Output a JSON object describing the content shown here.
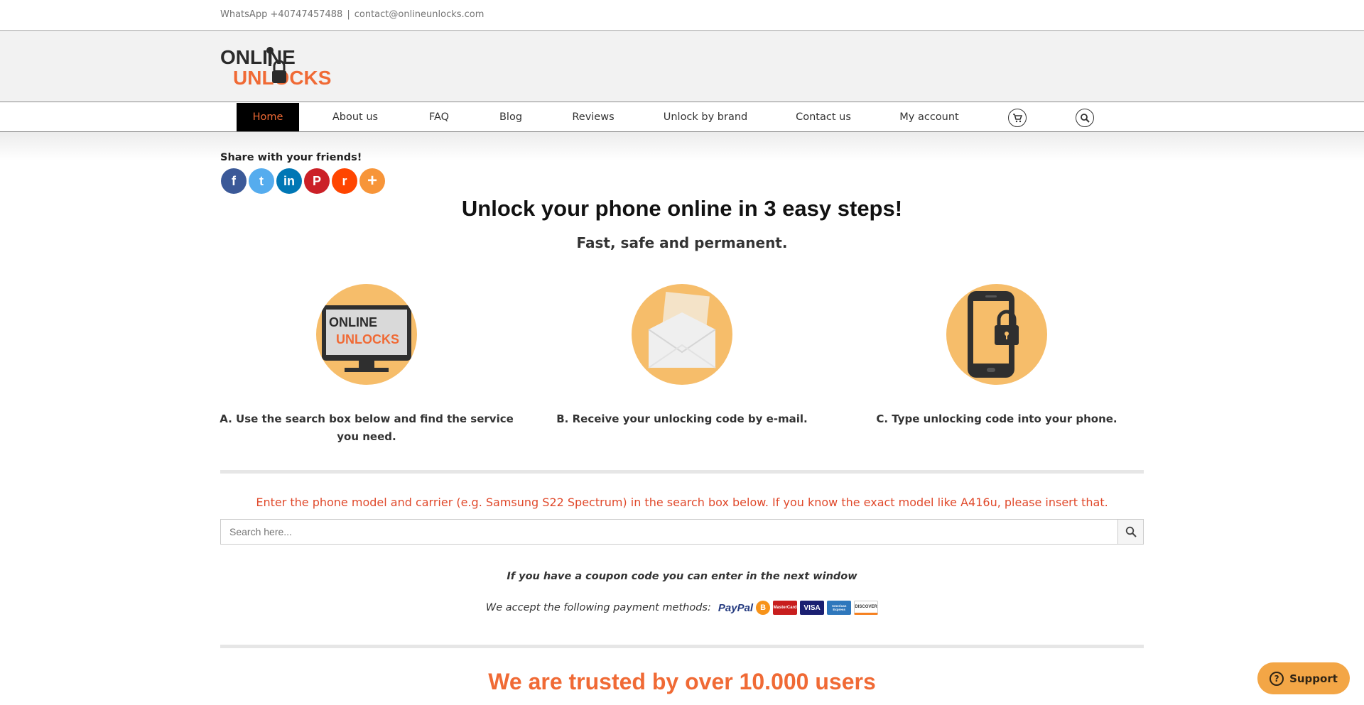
{
  "topbar": {
    "whatsapp": "WhatsApp +40747457488",
    "separator": "|",
    "email": "contact@onlineunlocks.com"
  },
  "logo": {
    "line1": "ONLINE",
    "line2": "UNLOCKS"
  },
  "nav": {
    "items": [
      {
        "label": "Home"
      },
      {
        "label": "About us"
      },
      {
        "label": "FAQ"
      },
      {
        "label": "Blog"
      },
      {
        "label": "Reviews"
      },
      {
        "label": "Unlock by brand"
      },
      {
        "label": "Contact us"
      },
      {
        "label": "My account"
      }
    ],
    "active": "Home",
    "icons": [
      "cart-icon",
      "search-icon"
    ]
  },
  "share": {
    "title": "Share with your friends!",
    "networks": [
      {
        "name": "facebook-icon",
        "glyph": "f",
        "color": "#3b5998"
      },
      {
        "name": "twitter-icon",
        "glyph": "t",
        "color": "#55acee"
      },
      {
        "name": "linkedin-icon",
        "glyph": "in",
        "color": "#0077b5"
      },
      {
        "name": "pinterest-icon",
        "glyph": "P",
        "color": "#cb2027"
      },
      {
        "name": "reddit-icon",
        "glyph": "r",
        "color": "#ff4500"
      },
      {
        "name": "more-icon",
        "glyph": "+",
        "color": "#f79539"
      }
    ]
  },
  "hero": {
    "title": "Unlock your phone online in 3 easy steps!",
    "subtitle": "Fast, safe and permanent."
  },
  "steps": [
    {
      "text": "A. Use the search box below and find the service you need.",
      "icon": "computer-icon"
    },
    {
      "text": "B. Receive your unlocking code by e-mail.",
      "icon": "envelope-icon"
    },
    {
      "text": "C. Type unlocking code into your phone.",
      "icon": "phone-lock-icon"
    }
  ],
  "search": {
    "hint": "Enter the phone model and carrier (e.g. Samsung S22 Spectrum) in the search box below. If you know the exact model like A416u, please insert that.",
    "placeholder": "Search here..."
  },
  "coupon": "If you have a coupon code you can enter in the next window",
  "payment": {
    "label": "We accept the following payment methods:",
    "methods": [
      "PayPal",
      "Bitcoin",
      "MasterCard",
      "VISA",
      "American Express",
      "DISCOVER"
    ]
  },
  "trusted": "We are trusted by over 10.000 users",
  "support": {
    "label": "Support"
  },
  "colors": {
    "accent": "#f06a35",
    "circle": "#f6bd6a",
    "hint": "#e0492b"
  }
}
